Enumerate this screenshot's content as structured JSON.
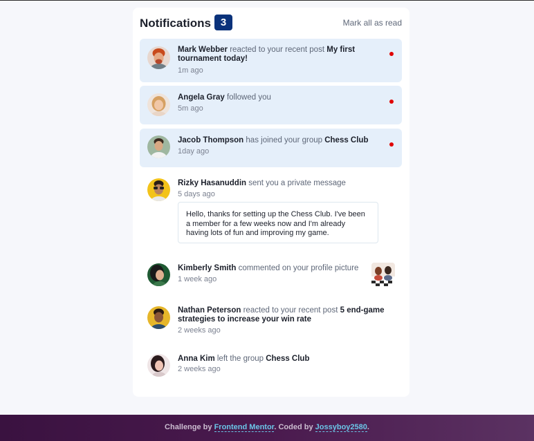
{
  "header": {
    "title": "Notifications",
    "count": "3",
    "mark_all": "Mark all as read"
  },
  "notifications": [
    {
      "user": "Mark Webber",
      "action": "reacted to your recent post",
      "target": "My first tournament today!",
      "time": "1m ago",
      "unread": true
    },
    {
      "user": "Angela Gray",
      "action": "followed you",
      "target": "",
      "time": "5m ago",
      "unread": true
    },
    {
      "user": "Jacob Thompson",
      "action": "has joined your group",
      "target": "Chess Club",
      "time": "1day ago",
      "unread": true
    },
    {
      "user": "Rizky Hasanuddin",
      "action": "sent you a private message",
      "target": "",
      "time": "5 days ago",
      "unread": false,
      "message": "Hello, thanks for setting up the Chess Club. I've been a member for a few weeks now and I'm already having lots of fun and improving my game."
    },
    {
      "user": "Kimberly Smith",
      "action": "commented on your profile picture",
      "target": "",
      "time": "1 week ago",
      "unread": false
    },
    {
      "user": "Nathan Peterson",
      "action": "reacted to your recent post",
      "target": "5 end-game strategies to increase your win rate",
      "time": "2 weeks ago",
      "unread": false
    },
    {
      "user": "Anna Kim",
      "action": "left the group",
      "target": "Chess Club",
      "time": "2 weeks ago",
      "unread": false
    }
  ],
  "footer": {
    "prefix": "Challenge by",
    "link1": "Frontend Mentor",
    "middle": ". Coded by",
    "link2": "Jossyboy2580",
    "suffix": "."
  },
  "colors": {
    "unread_bg": "#e5effa",
    "badge": "#0a327b",
    "dot": "#e00000",
    "footer_bg": "#3a1240"
  }
}
